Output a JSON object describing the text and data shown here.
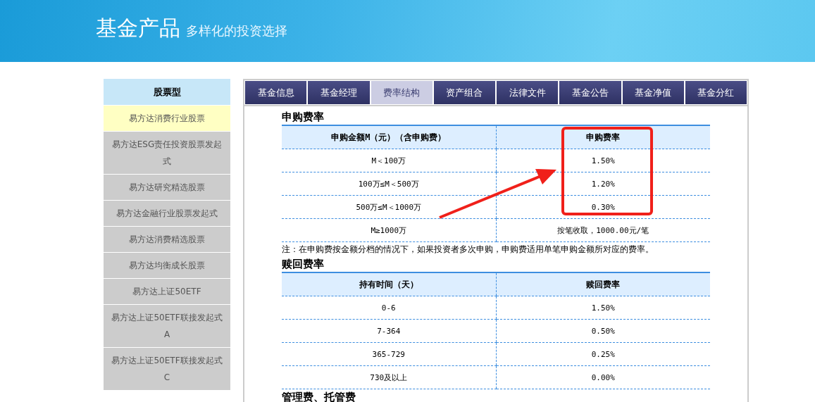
{
  "banner": {
    "title": "基金产品",
    "subtitle": "多样化的投资选择"
  },
  "sidebar": {
    "heading": "股票型",
    "items": [
      {
        "label": "易方达消费行业股票",
        "selected": true
      },
      {
        "label": "易方达ESG责任投资股票发起式",
        "selected": false
      },
      {
        "label": "易方达研究精选股票",
        "selected": false
      },
      {
        "label": "易方达金融行业股票发起式",
        "selected": false
      },
      {
        "label": "易方达消费精选股票",
        "selected": false
      },
      {
        "label": "易方达均衡成长股票",
        "selected": false
      },
      {
        "label": "易方达上证50ETF",
        "selected": false
      },
      {
        "label": "易方达上证50ETF联接发起式A",
        "selected": false
      },
      {
        "label": "易方达上证50ETF联接发起式C",
        "selected": false
      }
    ]
  },
  "tabs": [
    {
      "label": "基金信息",
      "selected": false
    },
    {
      "label": "基金经理",
      "selected": false
    },
    {
      "label": "费率结构",
      "selected": true
    },
    {
      "label": "资产组合",
      "selected": false
    },
    {
      "label": "法律文件",
      "selected": false
    },
    {
      "label": "基金公告",
      "selected": false
    },
    {
      "label": "基金净值",
      "selected": false
    },
    {
      "label": "基金分红",
      "selected": false
    }
  ],
  "sections": [
    {
      "title": "申购费率",
      "columns": [
        "申购金额M（元）（含申购费）",
        "申购费率"
      ],
      "rows": [
        [
          "M＜100万",
          "1.50%"
        ],
        [
          "100万≤M＜500万",
          "1.20%"
        ],
        [
          "500万≤M＜1000万",
          "0.30%"
        ],
        [
          "M≥1000万",
          "按笔收取，1000.00元/笔"
        ]
      ],
      "note": "注：在申购费按金额分档的情况下，如果投资者多次申购，申购费适用单笔申购金额所对应的费率。"
    },
    {
      "title": "赎回费率",
      "columns": [
        "持有时间（天）",
        "赎回费率"
      ],
      "rows": [
        [
          "0-6",
          "1.50%"
        ],
        [
          "7-364",
          "0.50%"
        ],
        [
          "365-729",
          "0.25%"
        ],
        [
          "730及以上",
          "0.00%"
        ]
      ]
    },
    {
      "title": "管理费、托管费"
    }
  ]
}
